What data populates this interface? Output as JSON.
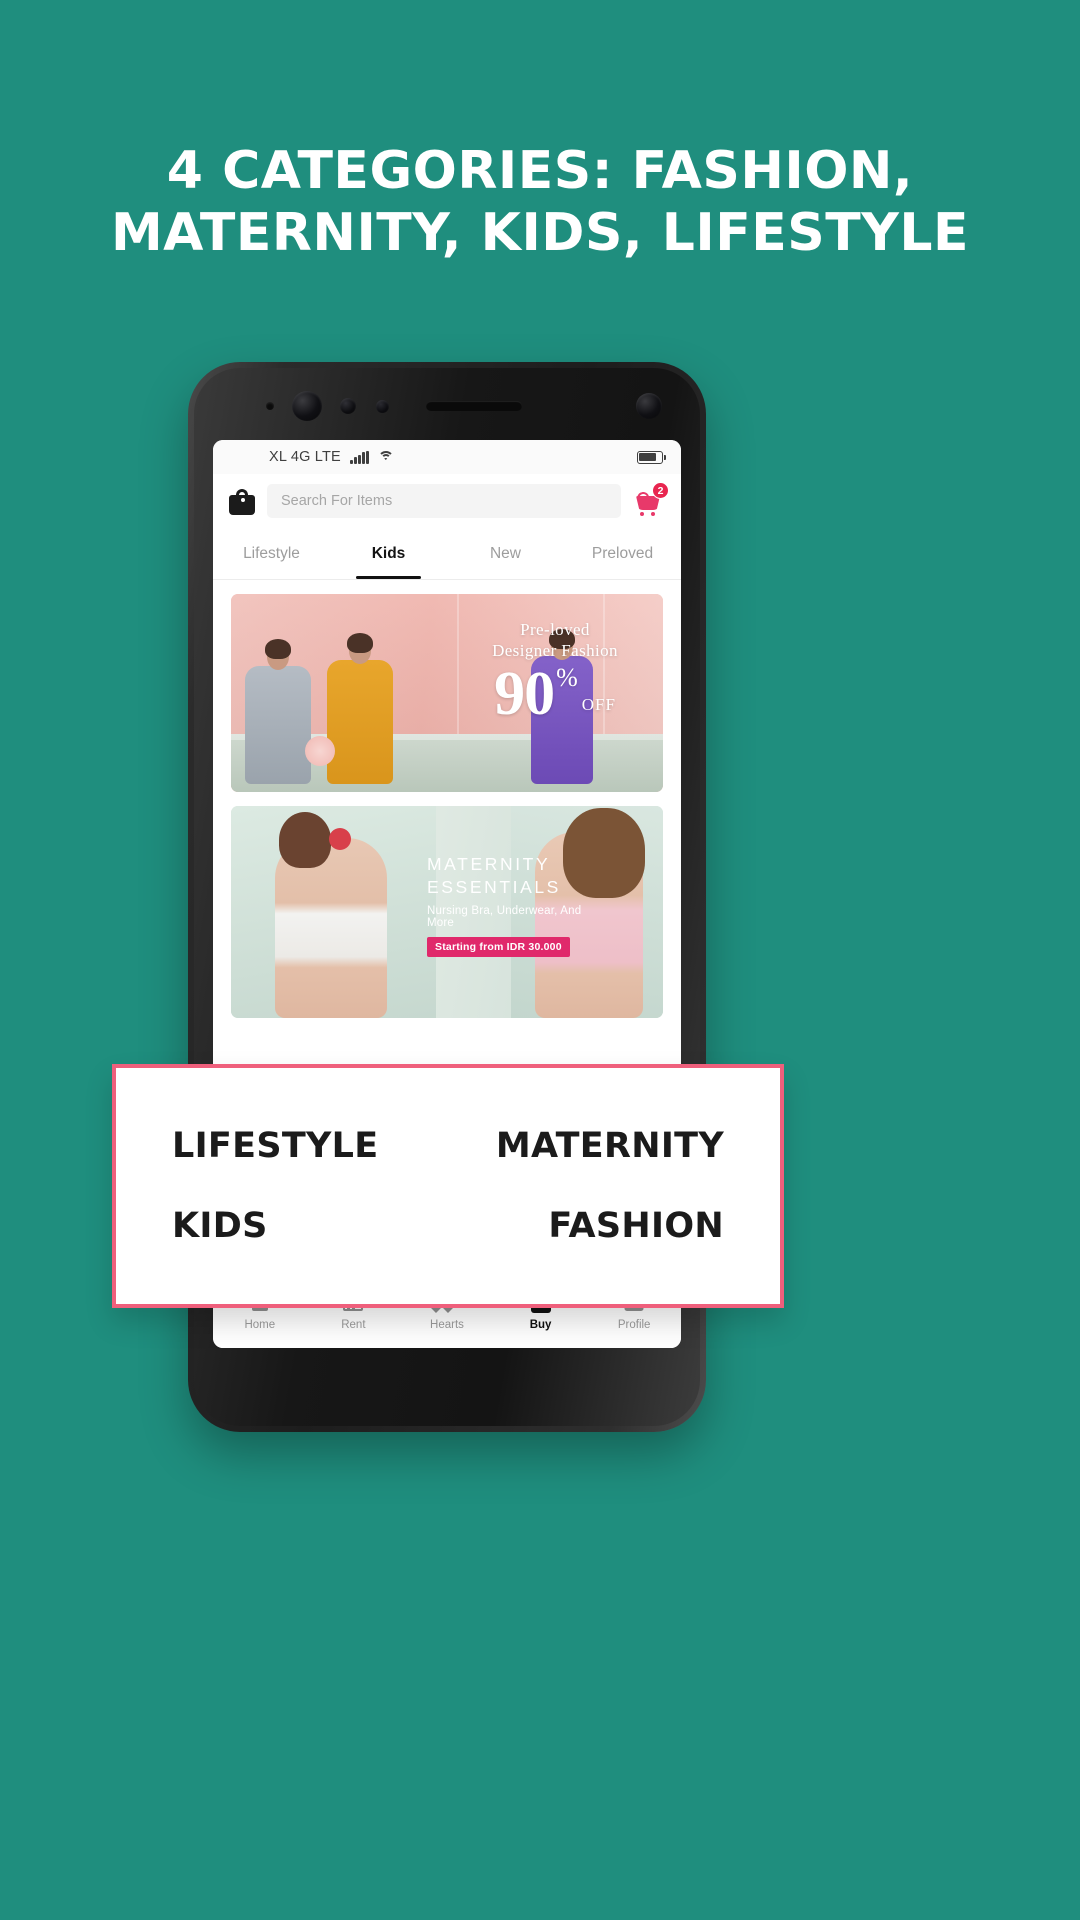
{
  "promo": {
    "background_color": "#1f8e7e",
    "headline_line1": "4 CATEGORIES: FASHION,",
    "headline_line2": "MATERNITY, KIDS, LIFESTYLE"
  },
  "phone": {
    "status_bar": {
      "carrier": "XL 4G LTE",
      "signal_icon": "signal-bars-icon",
      "wifi_icon": "wifi-icon",
      "battery_icon": "battery-icon"
    },
    "header": {
      "bag_icon": "shopping-bag-icon",
      "search_placeholder": "Search For Items",
      "search_value": "",
      "cart_icon": "shopping-cart-icon",
      "cart_badge_count": "2",
      "cart_badge_color": "#e8254f"
    },
    "tabs": [
      {
        "label": "Lifestyle",
        "active": false
      },
      {
        "label": "Kids",
        "active": true
      },
      {
        "label": "New",
        "active": false
      },
      {
        "label": "Preloved",
        "active": false
      }
    ],
    "banners": [
      {
        "name": "preloved-designer-fashion-banner",
        "line1": "Pre-loved",
        "line2": "Designer Fashion",
        "discount_number": "90",
        "discount_percent": "%",
        "discount_off": "OFF"
      },
      {
        "name": "maternity-essentials-banner",
        "title_line1": "MATERNITY",
        "title_line2": "ESSENTIALS",
        "subtitle": "Nursing Bra, Underwear, And More",
        "pill": "Starting from IDR 30.000",
        "pill_color": "#e0296b"
      }
    ],
    "bottom_nav": [
      {
        "label": "Home",
        "icon": "home-icon",
        "active": false
      },
      {
        "label": "Rent",
        "icon": "calendar-icon",
        "active": false
      },
      {
        "label": "Hearts",
        "icon": "heart-icon",
        "active": false
      },
      {
        "label": "Buy",
        "icon": "shopping-bag-icon",
        "active": true
      },
      {
        "label": "Profile",
        "icon": "person-icon",
        "active": false
      }
    ]
  },
  "overlay_card": {
    "border_color": "#ef5f7c",
    "items": [
      "LIFESTYLE",
      "MATERNITY",
      "KIDS",
      "FASHION"
    ]
  }
}
